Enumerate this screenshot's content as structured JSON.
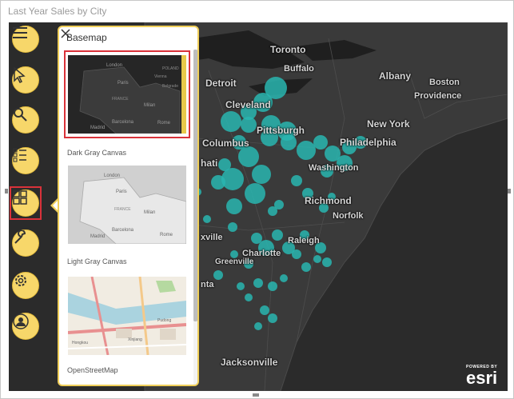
{
  "window": {
    "title": "Last Year Sales by City"
  },
  "colors": {
    "map_bg": "#2b2b2b",
    "bubble": "#29b6b0",
    "toolbar": "#f7d76a",
    "highlight": "#d9323a"
  },
  "toolbar": [
    {
      "name": "menu-icon"
    },
    {
      "name": "select-icon"
    },
    {
      "name": "search-icon"
    },
    {
      "name": "legend-icon"
    },
    {
      "name": "basemap-icon",
      "selected": true
    },
    {
      "name": "wrench-icon"
    },
    {
      "name": "settings-icon"
    },
    {
      "name": "user-icon"
    }
  ],
  "panel": {
    "title": "Basemap",
    "options": [
      {
        "label": "Dark Gray Canvas",
        "selected": true,
        "thumb_labels": [
          "London",
          "Paris",
          "FRANCE",
          "Milan",
          "Madrid",
          "Barcelona",
          "Rome",
          "Belgrade",
          "POLAND",
          "Vienna"
        ]
      },
      {
        "label": "Light Gray Canvas",
        "selected": false,
        "thumb_labels": [
          "London",
          "Paris",
          "FRANCE",
          "Milan",
          "Madrid",
          "Barcelona",
          "Rome"
        ]
      },
      {
        "label": "OpenStreetMap",
        "selected": false,
        "thumb_labels": [
          "Hongkou",
          "Xinjiang",
          "Pudong"
        ]
      }
    ]
  },
  "map": {
    "cities": [
      "Toronto",
      "Buffalo",
      "Albany",
      "Boston",
      "Providence",
      "Detroit",
      "Cleveland",
      "Pittsburgh",
      "New York",
      "Columbus",
      "Philadelphia",
      "Washington",
      "hati",
      "Richmond",
      "Norfolk",
      "xville",
      "Raleigh",
      "Charlotte",
      "Greenville",
      "nta",
      "Jacksonville"
    ]
  },
  "attribution": {
    "powered": "POWERED BY",
    "brand": "esri"
  }
}
